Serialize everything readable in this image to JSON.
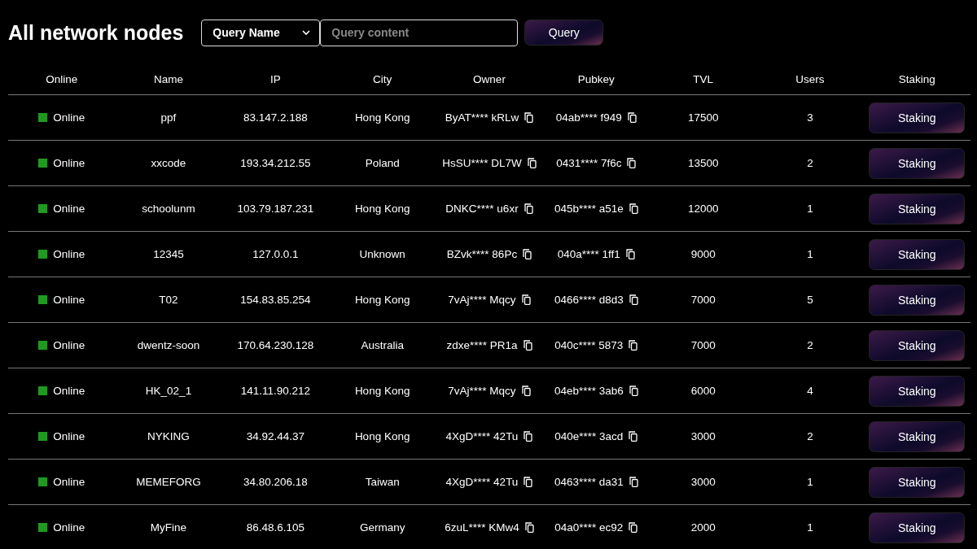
{
  "title": "All network nodes",
  "query": {
    "select": "Query Name",
    "placeholder": "Query content",
    "button": "Query"
  },
  "columns": [
    "Online",
    "Name",
    "IP",
    "City",
    "Owner",
    "Pubkey",
    "TVL",
    "Users",
    "Staking"
  ],
  "rows": [
    {
      "online": true,
      "status": "Online",
      "name": "ppf",
      "ip": "83.147.2.188",
      "city": "Hong Kong",
      "owner": "ByAT**** kRLw",
      "pubkey": "04ab**** f949",
      "tvl": "17500",
      "users": "3",
      "action": "Staking"
    },
    {
      "online": true,
      "status": "Online",
      "name": "xxcode",
      "ip": "193.34.212.55",
      "city": "Poland",
      "owner": "HsSU**** DL7W",
      "pubkey": "0431**** 7f6c",
      "tvl": "13500",
      "users": "2",
      "action": "Staking"
    },
    {
      "online": true,
      "status": "Online",
      "name": "schoolunm",
      "ip": "103.79.187.231",
      "city": "Hong Kong",
      "owner": "DNKC**** u6xr",
      "pubkey": "045b**** a51e",
      "tvl": "12000",
      "users": "1",
      "action": "Staking"
    },
    {
      "online": true,
      "status": "Online",
      "name": "12345",
      "ip": "127.0.0.1",
      "city": "Unknown",
      "owner": "BZvk**** 86Pc",
      "pubkey": "040a**** 1ff1",
      "tvl": "9000",
      "users": "1",
      "action": "Staking"
    },
    {
      "online": true,
      "status": "Online",
      "name": "T02",
      "ip": "154.83.85.254",
      "city": "Hong Kong",
      "owner": "7vAj**** Mqcy",
      "pubkey": "0466**** d8d3",
      "tvl": "7000",
      "users": "5",
      "action": "Staking"
    },
    {
      "online": true,
      "status": "Online",
      "name": "dwentz-soon",
      "ip": "170.64.230.128",
      "city": "Australia",
      "owner": "zdxe**** PR1a",
      "pubkey": "040c**** 5873",
      "tvl": "7000",
      "users": "2",
      "action": "Staking"
    },
    {
      "online": true,
      "status": "Online",
      "name": "HK_02_1",
      "ip": "141.11.90.212",
      "city": "Hong Kong",
      "owner": "7vAj**** Mqcy",
      "pubkey": "04eb**** 3ab6",
      "tvl": "6000",
      "users": "4",
      "action": "Staking"
    },
    {
      "online": true,
      "status": "Online",
      "name": "NYKING",
      "ip": "34.92.44.37",
      "city": "Hong Kong",
      "owner": "4XgD**** 42Tu",
      "pubkey": "040e**** 3acd",
      "tvl": "3000",
      "users": "2",
      "action": "Staking"
    },
    {
      "online": true,
      "status": "Online",
      "name": "MEMEFORG",
      "ip": "34.80.206.18",
      "city": "Taiwan",
      "owner": "4XgD**** 42Tu",
      "pubkey": "0463**** da31",
      "tvl": "3000",
      "users": "1",
      "action": "Staking"
    },
    {
      "online": true,
      "status": "Online",
      "name": "MyFine",
      "ip": "86.48.6.105",
      "city": "Germany",
      "owner": "6zuL**** KMw4",
      "pubkey": "04a0**** ec92",
      "tvl": "2000",
      "users": "1",
      "action": "Staking"
    }
  ]
}
